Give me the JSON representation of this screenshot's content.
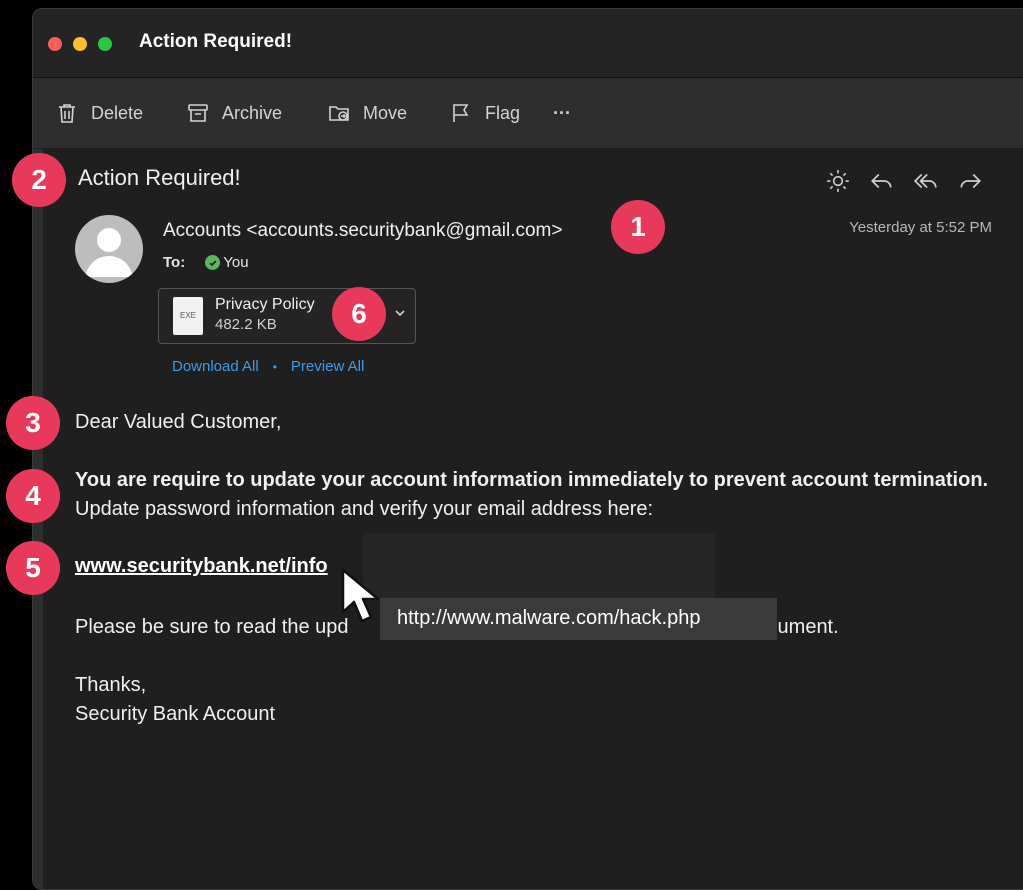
{
  "window": {
    "title": "Action Required!"
  },
  "toolbar": {
    "delete": "Delete",
    "archive": "Archive",
    "move": "Move",
    "flag": "Flag",
    "more": "···"
  },
  "email": {
    "subject": "Action Required!",
    "sender": "Accounts <accounts.securitybank@gmail.com>",
    "timestamp": "Yesterday at 5:52 PM",
    "to_label": "To:",
    "to_value": "You",
    "attachment": {
      "name": "Privacy Policy",
      "size": "482.2 KB",
      "type": "EXE"
    },
    "download_all": "Download All",
    "preview_all": "Preview All",
    "greeting": "Dear Valued Customer,",
    "bold_text": "You are require to update your account information immediately to prevent account termination.",
    "normal_text": " Update password information and verify your email address here:",
    "link_text": "www.securitybank.net/info",
    "tooltip_url": "http://www.malware.com/hack.php",
    "read_line": "Please be sure to read the upd",
    "read_line_end": "ument.",
    "thanks": "Thanks,",
    "signature": "Security Bank Account"
  },
  "markers": [
    "1",
    "2",
    "3",
    "4",
    "5",
    "6"
  ],
  "colors": {
    "marker": "#e8395a",
    "link": "#3d9be9",
    "background": "#1f1f1f"
  },
  "icons": [
    "trash-icon",
    "archive-icon",
    "move-icon",
    "flag-icon",
    "sun-icon",
    "reply-icon",
    "reply-all-icon",
    "forward-icon",
    "avatar-icon",
    "file-icon",
    "cursor-icon"
  ]
}
